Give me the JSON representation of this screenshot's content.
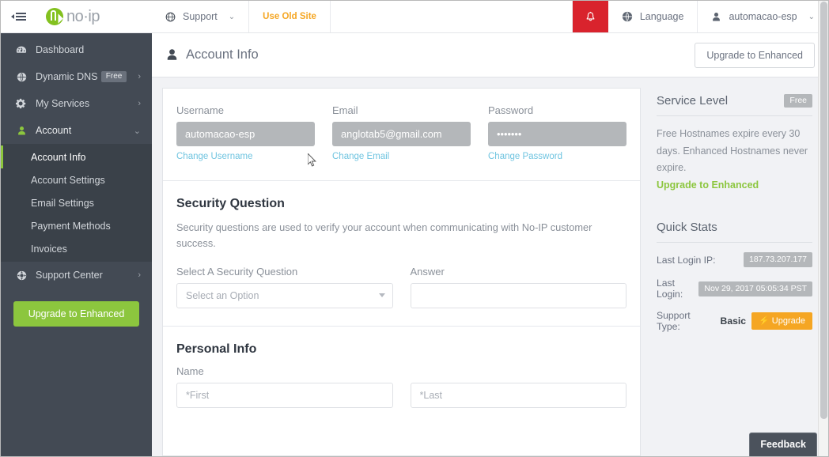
{
  "brand": {
    "logo_text": "no·ip",
    "accent_green": "#8cc63e",
    "accent_amber": "#f5a623",
    "accent_red": "#d9232d",
    "sidebar_bg": "#434a54"
  },
  "sidebar": {
    "collapse_icon": "collapse-menu-icon",
    "items": [
      {
        "label": "Dashboard",
        "icon": "dashboard-icon",
        "badge": "",
        "chevron": ""
      },
      {
        "label": "Dynamic DNS",
        "icon": "globe-icon",
        "badge": "Free",
        "chevron": "›"
      },
      {
        "label": "My Services",
        "icon": "gear-icon",
        "badge": "",
        "chevron": "›"
      },
      {
        "label": "Account",
        "icon": "user-icon",
        "badge": "",
        "chevron": "⌄"
      }
    ],
    "sub_items": [
      {
        "label": "Account Info",
        "active": true
      },
      {
        "label": "Account Settings",
        "active": false
      },
      {
        "label": "Email Settings",
        "active": false
      },
      {
        "label": "Payment Methods",
        "active": false
      },
      {
        "label": "Invoices",
        "active": false
      }
    ],
    "support_center": {
      "label": "Support Center",
      "icon": "support-globe-icon",
      "chevron": "›"
    },
    "upgrade_button": "Upgrade to Enhanced"
  },
  "topbar": {
    "support": {
      "label": "Support",
      "icon": "globe-icon",
      "chevron": "⌄"
    },
    "use_old_site": "Use Old Site",
    "bell": "notification-bell-icon",
    "language": {
      "label": "Language",
      "icon": "globe-icon"
    },
    "user": {
      "label": "automacao-esp",
      "icon": "user-icon",
      "chevron": "⌄"
    }
  },
  "pagehead": {
    "icon": "user-icon",
    "title": "Account Info",
    "upgrade_button": "Upgrade to Enhanced"
  },
  "account_fields": {
    "username": {
      "label": "Username",
      "value": "automacao-esp",
      "link": "Change Username"
    },
    "email": {
      "label": "Email",
      "value": "anglotab5@gmail.com",
      "link": "Change Email"
    },
    "password": {
      "label": "Password",
      "value": "•••••••",
      "link": "Change Password"
    }
  },
  "security_question": {
    "title": "Security Question",
    "description": "Security questions are used to verify your account when communicating with No-IP customer success.",
    "select_label": "Select A Security Question",
    "select_value": "Select an Option",
    "answer_label": "Answer",
    "answer_value": "",
    "answer_placeholder": ""
  },
  "personal_info": {
    "title": "Personal Info",
    "name_label": "Name",
    "first_placeholder": "*First",
    "first_value": "",
    "last_placeholder": "*Last",
    "last_value": ""
  },
  "service_level": {
    "title": "Service Level",
    "badge": "Free",
    "description": "Free Hostnames expire every 30 days. Enhanced Hostnames never expire.",
    "upgrade_link": "Upgrade to Enhanced"
  },
  "quick_stats": {
    "title": "Quick Stats",
    "rows": [
      {
        "label": "Last Login IP:",
        "value": "187.73.207.177",
        "type": "pill"
      },
      {
        "label": "Last Login:",
        "value": "Nov 29, 2017 05:05:34 PST",
        "type": "pill"
      },
      {
        "label": "Support Type:",
        "strong": "Basic",
        "value": "⚡ Upgrade",
        "type": "button"
      }
    ]
  },
  "feedback": {
    "label": "Feedback"
  }
}
